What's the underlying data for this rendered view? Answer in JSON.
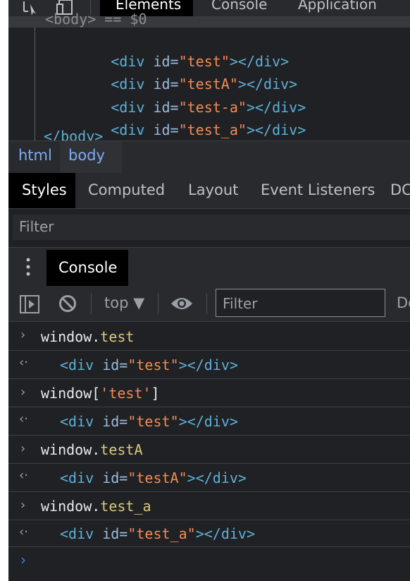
{
  "toolbar": {
    "tabs": [
      "Elements",
      "Console",
      "Application"
    ],
    "active_tab": "Elements"
  },
  "dom_tree": {
    "partial_top": "<body> == $0",
    "lines": [
      {
        "id": "test"
      },
      {
        "id": "testA"
      },
      {
        "id": "test-a"
      },
      {
        "id": "test_a"
      }
    ],
    "closing": "</body>"
  },
  "breadcrumbs": [
    "html",
    "body"
  ],
  "style_tabs": [
    "Styles",
    "Computed",
    "Layout",
    "Event Listeners",
    "DC"
  ],
  "styles_filter_placeholder": "Filter",
  "drawer": {
    "menu_icon": "kebab-menu-icon",
    "active_tab": "Console"
  },
  "console_toolbar": {
    "context": "top ▼",
    "filter_placeholder": "Filter",
    "level_partial": "De"
  },
  "console_entries": [
    {
      "input_obj": "window",
      "input_sep": ".",
      "input_prop": "test",
      "input_close": "",
      "output_id": "test"
    },
    {
      "input_obj": "window",
      "input_sep": "[",
      "input_prop": "'test'",
      "input_close": "]",
      "output_id": "test"
    },
    {
      "input_obj": "window",
      "input_sep": ".",
      "input_prop": "testA",
      "input_close": "",
      "output_id": "testA"
    },
    {
      "input_obj": "window",
      "input_sep": ".",
      "input_prop": "test_a",
      "input_close": "",
      "output_id": "test_a"
    }
  ],
  "code": {
    "div_open": "<div",
    "id_attr": " id=",
    "quote": "\"",
    "close_open": ">",
    "div_close": "</div>"
  },
  "colors": {
    "background": "#202124",
    "tag": "#5db0d7",
    "attribute": "#9bbbdc",
    "value": "#f28b54",
    "property": "#d9c97c",
    "link": "#7cacf8"
  }
}
